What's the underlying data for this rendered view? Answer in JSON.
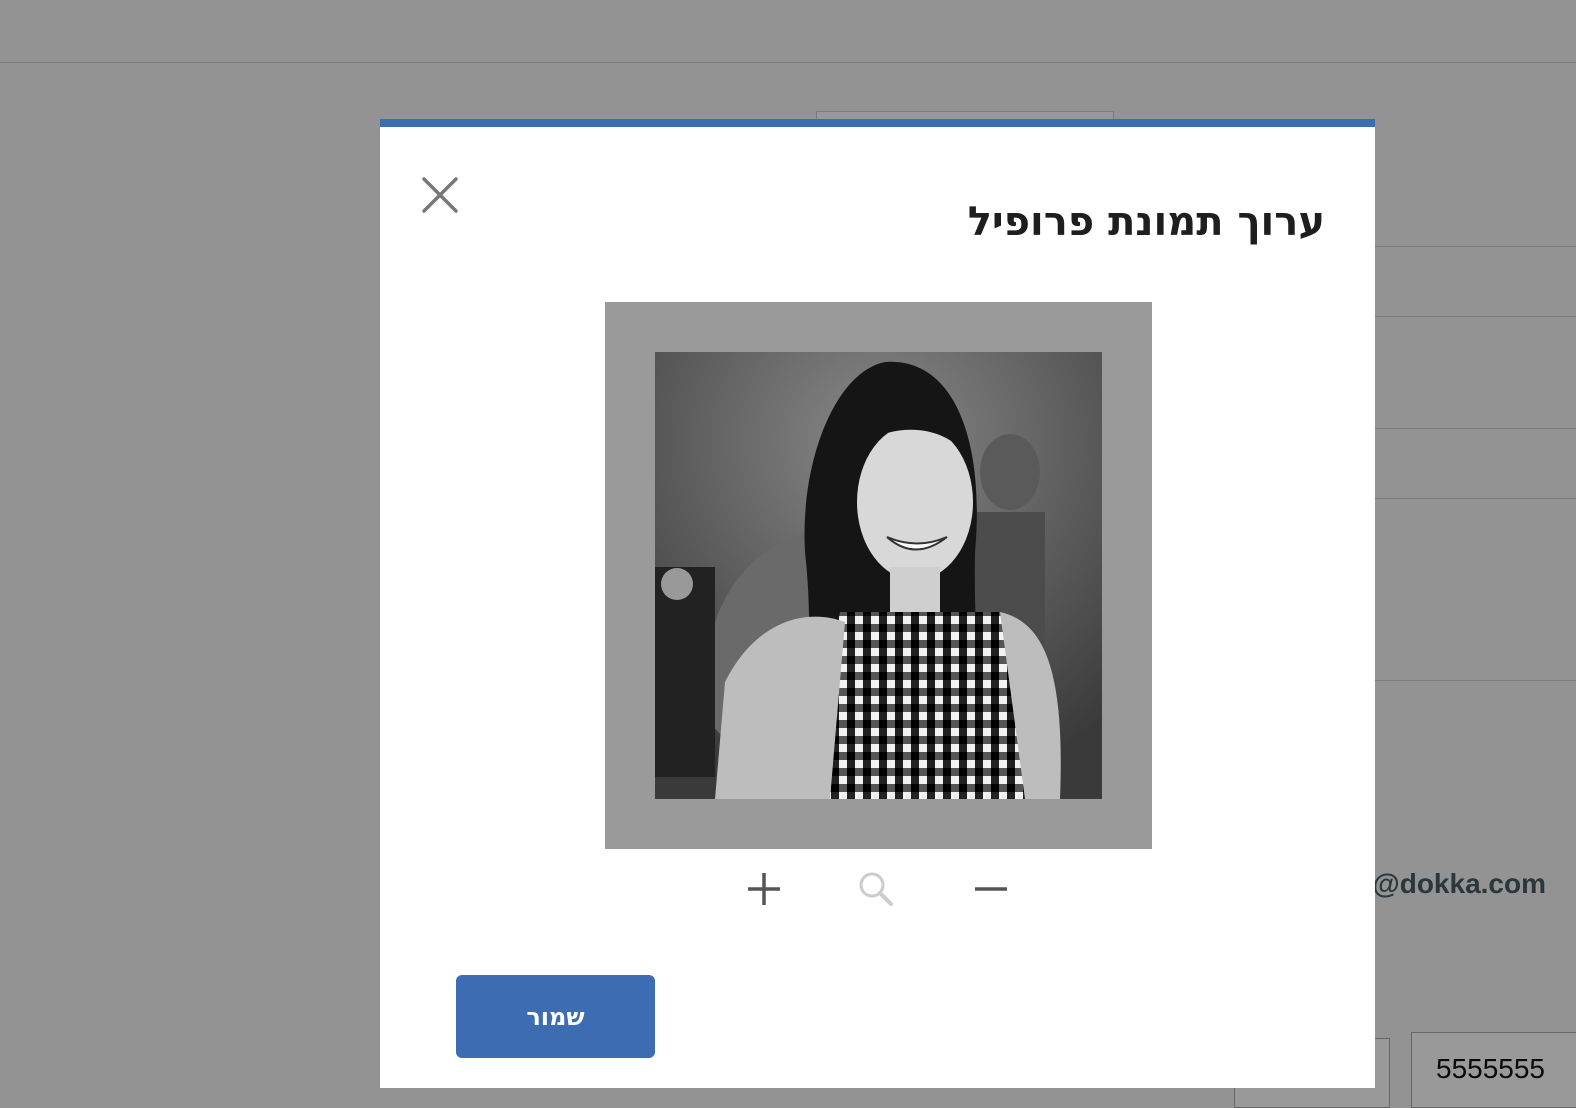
{
  "modal": {
    "title": "ערוך תמונת פרופיל",
    "save_label": "שמור",
    "accent_color": "#3d6cb3"
  },
  "controls": {
    "zoom_in_icon": "plus-icon",
    "zoom_icon": "search-icon",
    "zoom_out_icon": "minus-icon"
  },
  "background": {
    "email_fragment": "@dokka.com",
    "phone_value": "5555555"
  }
}
